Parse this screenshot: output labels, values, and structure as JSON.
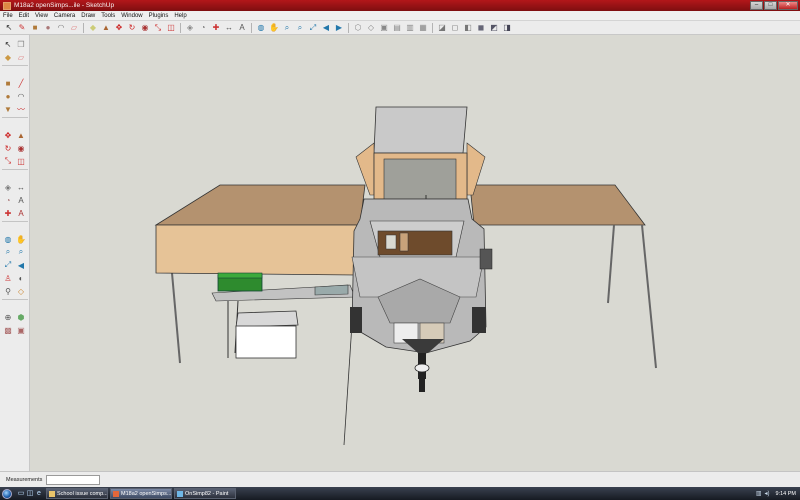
{
  "window": {
    "title": "M18a2 openSimps...ile - SketchUp"
  },
  "menu": [
    "File",
    "Edit",
    "View",
    "Camera",
    "Draw",
    "Tools",
    "Window",
    "Plugins",
    "Help"
  ],
  "window_buttons": {
    "minimize": "–",
    "maximize": "□",
    "close": "✕"
  },
  "top_toolbar_icons": [
    {
      "name": "select-icon",
      "glyph": "↖",
      "color": "#222"
    },
    {
      "name": "pencil-icon",
      "glyph": "✎",
      "color": "#c33"
    },
    {
      "name": "rectangle-icon",
      "glyph": "■",
      "color": "#b07a3a"
    },
    {
      "name": "circle-icon",
      "glyph": "●",
      "color": "#a77"
    },
    {
      "name": "arc-icon",
      "glyph": "◠",
      "color": "#777"
    },
    {
      "name": "eraser-icon",
      "glyph": "▱",
      "color": "#d77"
    },
    {
      "name": "paint-bucket-icon",
      "glyph": "◆",
      "color": "#cc7"
    },
    {
      "name": "push-pull-icon",
      "glyph": "▲",
      "color": "#a63"
    },
    {
      "name": "move-icon",
      "glyph": "✥",
      "color": "#c22"
    },
    {
      "name": "rotate-icon",
      "glyph": "↻",
      "color": "#c22"
    },
    {
      "name": "follow-me-icon",
      "glyph": "◉",
      "color": "#a33"
    },
    {
      "name": "scale-icon",
      "glyph": "⤡",
      "color": "#c22"
    },
    {
      "name": "offset-icon",
      "glyph": "◫",
      "color": "#c33"
    },
    {
      "name": "tape-measure-icon",
      "glyph": "◈",
      "color": "#888"
    },
    {
      "name": "protractor-icon",
      "glyph": "◔",
      "color": "#777"
    },
    {
      "name": "axes-icon",
      "glyph": "✚",
      "color": "#c33"
    },
    {
      "name": "dimension-icon",
      "glyph": "↔",
      "color": "#555"
    },
    {
      "name": "text-icon",
      "glyph": "A",
      "color": "#555"
    },
    {
      "name": "orbit-icon",
      "glyph": "◍",
      "color": "#27a"
    },
    {
      "name": "pan-icon",
      "glyph": "✋",
      "color": "#b84"
    },
    {
      "name": "zoom-icon",
      "glyph": "⌕",
      "color": "#27a"
    },
    {
      "name": "zoom-window-icon",
      "glyph": "⌕",
      "color": "#27a"
    },
    {
      "name": "zoom-extents-icon",
      "glyph": "⤢",
      "color": "#27a"
    },
    {
      "name": "previous-view-icon",
      "glyph": "◀",
      "color": "#27a"
    },
    {
      "name": "next-view-icon",
      "glyph": "▶",
      "color": "#27a"
    },
    {
      "name": "iso-view-icon",
      "glyph": "⬡",
      "color": "#888"
    },
    {
      "name": "top-view-icon",
      "glyph": "◇",
      "color": "#888"
    },
    {
      "name": "front-view-icon",
      "glyph": "▣",
      "color": "#888"
    },
    {
      "name": "right-view-icon",
      "glyph": "▤",
      "color": "#888"
    },
    {
      "name": "back-view-icon",
      "glyph": "▥",
      "color": "#888"
    },
    {
      "name": "left-view-icon",
      "glyph": "▦",
      "color": "#888"
    },
    {
      "name": "xray-icon",
      "glyph": "◪",
      "color": "#777"
    },
    {
      "name": "wireframe-icon",
      "glyph": "◻",
      "color": "#777"
    },
    {
      "name": "hidden-line-icon",
      "glyph": "◧",
      "color": "#777"
    },
    {
      "name": "shaded-icon",
      "glyph": "◼",
      "color": "#667"
    },
    {
      "name": "textured-icon",
      "glyph": "◩",
      "color": "#556"
    },
    {
      "name": "monochrome-icon",
      "glyph": "◨",
      "color": "#445"
    }
  ],
  "left_toolbar_icons": [
    {
      "name": "select-icon",
      "glyph": "↖",
      "color": "#222"
    },
    {
      "name": "make-component-icon",
      "glyph": "❒",
      "color": "#888"
    },
    {
      "name": "paint-bucket-icon",
      "glyph": "◆",
      "color": "#c94"
    },
    {
      "name": "eraser-icon",
      "glyph": "▱",
      "color": "#d77"
    },
    {
      "name": "rectangle-icon",
      "glyph": "■",
      "color": "#b07a3a"
    },
    {
      "name": "line-icon",
      "glyph": "╱",
      "color": "#c33"
    },
    {
      "name": "circle-icon",
      "glyph": "●",
      "color": "#b07a3a"
    },
    {
      "name": "arc-icon",
      "glyph": "◠",
      "color": "#555"
    },
    {
      "name": "polygon-icon",
      "glyph": "▼",
      "color": "#b07a3a"
    },
    {
      "name": "freehand-icon",
      "glyph": "〰",
      "color": "#c33"
    },
    {
      "name": "move-icon",
      "glyph": "✥",
      "color": "#c22"
    },
    {
      "name": "push-pull-icon",
      "glyph": "▲",
      "color": "#a63"
    },
    {
      "name": "rotate-icon",
      "glyph": "↻",
      "color": "#c22"
    },
    {
      "name": "follow-me-icon",
      "glyph": "◉",
      "color": "#a33"
    },
    {
      "name": "scale-icon",
      "glyph": "⤡",
      "color": "#c22"
    },
    {
      "name": "offset-icon",
      "glyph": "◫",
      "color": "#c33"
    },
    {
      "name": "tape-measure-icon",
      "glyph": "◈",
      "color": "#777"
    },
    {
      "name": "dimension-icon",
      "glyph": "↔",
      "color": "#555"
    },
    {
      "name": "protractor-icon",
      "glyph": "◔",
      "color": "#a77"
    },
    {
      "name": "text-icon",
      "glyph": "A",
      "color": "#555"
    },
    {
      "name": "axes-icon",
      "glyph": "✚",
      "color": "#c33"
    },
    {
      "name": "3d-text-icon",
      "glyph": "A",
      "color": "#a33"
    },
    {
      "name": "orbit-icon",
      "glyph": "◍",
      "color": "#27a"
    },
    {
      "name": "pan-icon",
      "glyph": "✋",
      "color": "#b84"
    },
    {
      "name": "zoom-icon",
      "glyph": "⌕",
      "color": "#27a"
    },
    {
      "name": "zoom-window-icon",
      "glyph": "⌕",
      "color": "#27a"
    },
    {
      "name": "zoom-extents-icon",
      "glyph": "⤢",
      "color": "#27a"
    },
    {
      "name": "previous-view-icon",
      "glyph": "◀",
      "color": "#27a"
    },
    {
      "name": "position-camera-icon",
      "glyph": "♙",
      "color": "#c33"
    },
    {
      "name": "look-around-icon",
      "glyph": "◐",
      "color": "#555"
    },
    {
      "name": "walk-icon",
      "glyph": "⚲",
      "color": "#555"
    },
    {
      "name": "section-plane-icon",
      "glyph": "◇",
      "color": "#c83"
    },
    {
      "name": "add-location-icon",
      "glyph": "⊕",
      "color": "#555"
    },
    {
      "name": "toggle-terrain-icon",
      "glyph": "⬢",
      "color": "#6a6"
    },
    {
      "name": "photo-textures-icon",
      "glyph": "▩",
      "color": "#a66"
    },
    {
      "name": "get-models-icon",
      "glyph": "▣",
      "color": "#a66"
    }
  ],
  "status": {
    "measurements_label": "Measurements",
    "measurements_value": ""
  },
  "taskbar": {
    "tasks": [
      {
        "label": "School issue comp...",
        "active": false,
        "color": "#e9c46a"
      },
      {
        "label": "M18a2 openSimps...",
        "active": true,
        "color": "#e3673a"
      },
      {
        "label": "OnSimp82 - Paint",
        "active": false,
        "color": "#6fb7e6"
      }
    ],
    "clock": "9:14 PM"
  },
  "colors": {
    "viewport_bg": "#d9d9d2",
    "awning": "#d2aa84",
    "awning_dark": "#a88464",
    "trailer_body": "#b9b9b9",
    "cooler_green": "#2e8b2e"
  }
}
